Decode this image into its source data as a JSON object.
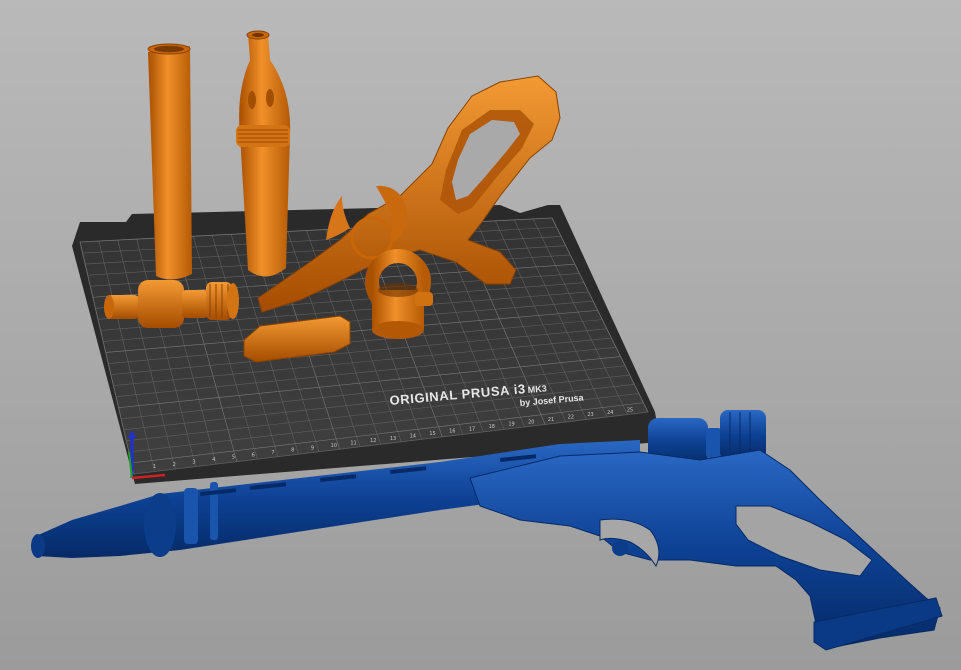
{
  "app": "PrusaSlicer 3D view",
  "bed": {
    "brand_title": "ORIGINAL PRUSA i3",
    "brand_model": "MK3",
    "brand_by": "by Josef Prusa",
    "front_ticks": [
      "1",
      "2",
      "3",
      "4",
      "5",
      "6",
      "7",
      "8",
      "9",
      "10",
      "11",
      "12",
      "13",
      "14",
      "15",
      "16",
      "17",
      "18",
      "19",
      "20",
      "21",
      "22",
      "23",
      "24",
      "25"
    ]
  },
  "objects": [
    {
      "name": "barrel-tube",
      "color": "#e07a10"
    },
    {
      "name": "muzzle-part",
      "color": "#e07a10"
    },
    {
      "name": "grip-frame",
      "color": "#e07a10"
    },
    {
      "name": "cylinder-part",
      "color": "#e07a10"
    },
    {
      "name": "ring-part",
      "color": "#e07a10"
    },
    {
      "name": "small-block-part",
      "color": "#e07a10"
    },
    {
      "name": "assembled-blaster",
      "color": "#0a3f8e"
    }
  ],
  "colors": {
    "printable": "#e07a10",
    "selected_assembly": "#0a3f8e",
    "bed_surface": "#3a3a3a",
    "bed_grid": "#5c5c5c",
    "background": "#aaaaaa"
  },
  "axes": {
    "x_color": "#d02020",
    "y_color": "#20a020",
    "z_color": "#2030d0"
  }
}
